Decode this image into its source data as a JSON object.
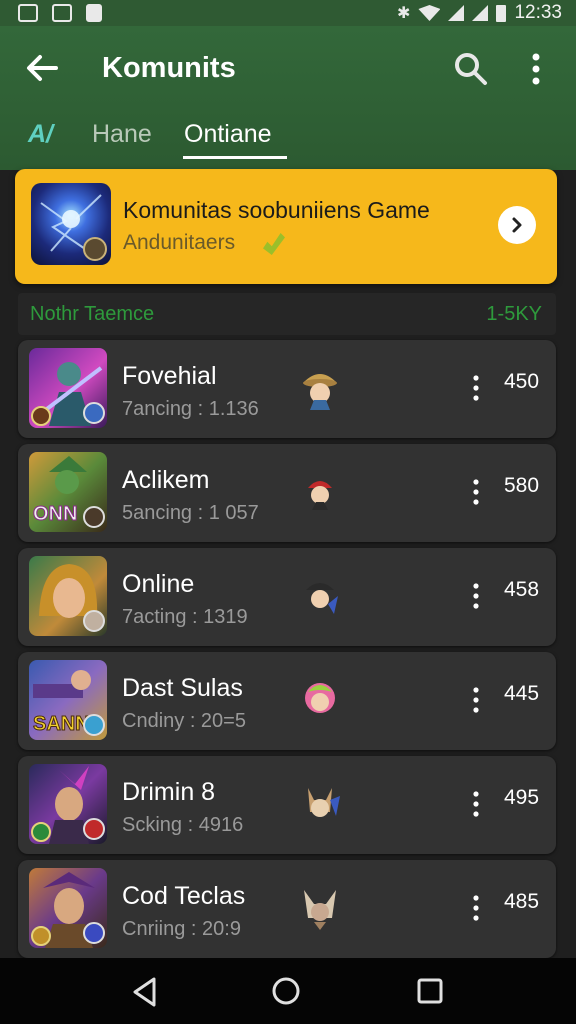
{
  "status_bar": {
    "time": "12:33"
  },
  "app_bar": {
    "title": "Komunits"
  },
  "tabs": [
    {
      "label": "A/",
      "active": false
    },
    {
      "label": "Hane",
      "active": false
    },
    {
      "label": "Ontiane",
      "active": true
    }
  ],
  "featured": {
    "title": "Komunitas soobuniiens Game",
    "subtitle": "Andunitaers"
  },
  "section": {
    "title": "Nothr Taemce",
    "count": "1-5KY"
  },
  "rows": [
    {
      "name": "Fovehial",
      "stat": "7ancing : 1.136",
      "value": "450"
    },
    {
      "name": "Aclikem",
      "stat": "5ancing : 1 057",
      "value": "580"
    },
    {
      "name": "Online",
      "stat": "7acting : 1319",
      "value": "458"
    },
    {
      "name": "Dast Sulas",
      "stat": "Cndiny : 20=5",
      "value": "445"
    },
    {
      "name": "Drimin 8",
      "stat": "Scking : 4916",
      "value": "495"
    },
    {
      "name": "Cod Teclas",
      "stat": "Cnriing : 20:9",
      "value": "485"
    }
  ],
  "colors": {
    "app_bar": "#2f5a33",
    "accent_yellow": "#f6b81b",
    "section_green": "#2e9a3c",
    "row_bg": "#323232"
  },
  "icons": [
    "back-arrow-icon",
    "search-icon",
    "more-vert-icon",
    "chevron-right-icon",
    "nav-back-icon",
    "nav-home-icon",
    "nav-recents-icon"
  ]
}
